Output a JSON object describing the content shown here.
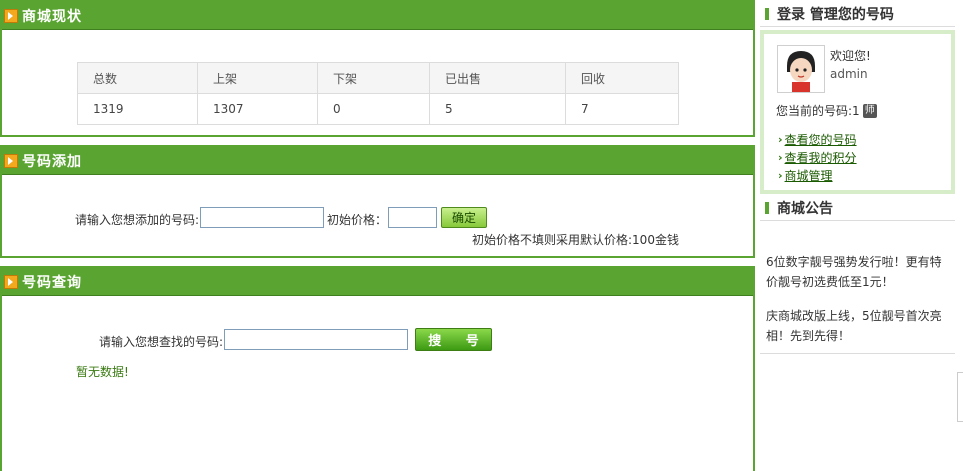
{
  "status_panel": {
    "title": "商城现状",
    "headers": [
      "总数",
      "上架",
      "下架",
      "已出售",
      "回收"
    ],
    "values": [
      "1319",
      "1307",
      "0",
      "5",
      "7"
    ]
  },
  "add_panel": {
    "title": "号码添加",
    "number_label": "请输入您想添加的号码:",
    "price_label": "初始价格：",
    "confirm_label": "确定",
    "note": "初始价格不填则采用默认价格:100金钱"
  },
  "query_panel": {
    "title": "号码查询",
    "search_label": "请输入您想查找的号码:",
    "search_button": "搜 号",
    "empty_text": "暂无数据!"
  },
  "login": {
    "title": "登录 管理您的号码",
    "welcome": "欢迎您!",
    "username": "admin",
    "current_number": "您当前的号码:1",
    "badge": "师",
    "links": [
      "查看您的号码",
      "查看我的积分",
      "商城管理"
    ]
  },
  "notice": {
    "title": "商城公告",
    "items": [
      "6位数字靓号强势发行啦！更有特价靓号初选费低至1元！",
      "庆商城改版上线，5位靓号首次亮相！先到先得！"
    ]
  },
  "colors": {
    "accent": "#5aa531",
    "icon": "#f2a91e"
  }
}
